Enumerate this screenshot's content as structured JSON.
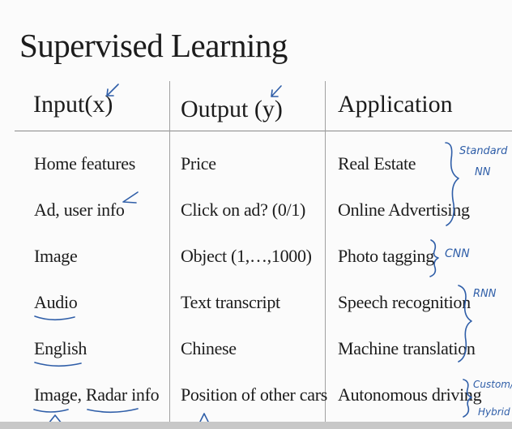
{
  "slide": {
    "title": "Supervised Learning"
  },
  "table": {
    "headers": {
      "input": "Input(x)",
      "output": "Output (y)",
      "application": "Application"
    },
    "rows": [
      {
        "input": "Home features",
        "output": "Price",
        "application": "Real Estate"
      },
      {
        "input": "Ad, user info",
        "output": "Click on ad? (0/1)",
        "application": "Online Advertising"
      },
      {
        "input": "Image",
        "output": "Object (1,…,1000)",
        "application": "Photo tagging"
      },
      {
        "input": "Audio",
        "output": "Text transcript",
        "application": "Speech recognition"
      },
      {
        "input": "English",
        "output": "Chinese",
        "application": "Machine translation"
      },
      {
        "input": "Image, Radar info",
        "output": "Position of other cars",
        "application": "Autonomous driving"
      }
    ]
  },
  "annotations": {
    "standard_nn_line1": "Standard",
    "standard_nn_line2": "NN",
    "cnn": "CNN",
    "rnn": "RNN",
    "custom_line1": "Custom/",
    "custom_line2": "Hybrid"
  },
  "colors": {
    "ink": "#2f5ea8",
    "text": "#1c1c1c",
    "rule": "#8a8a8a"
  }
}
